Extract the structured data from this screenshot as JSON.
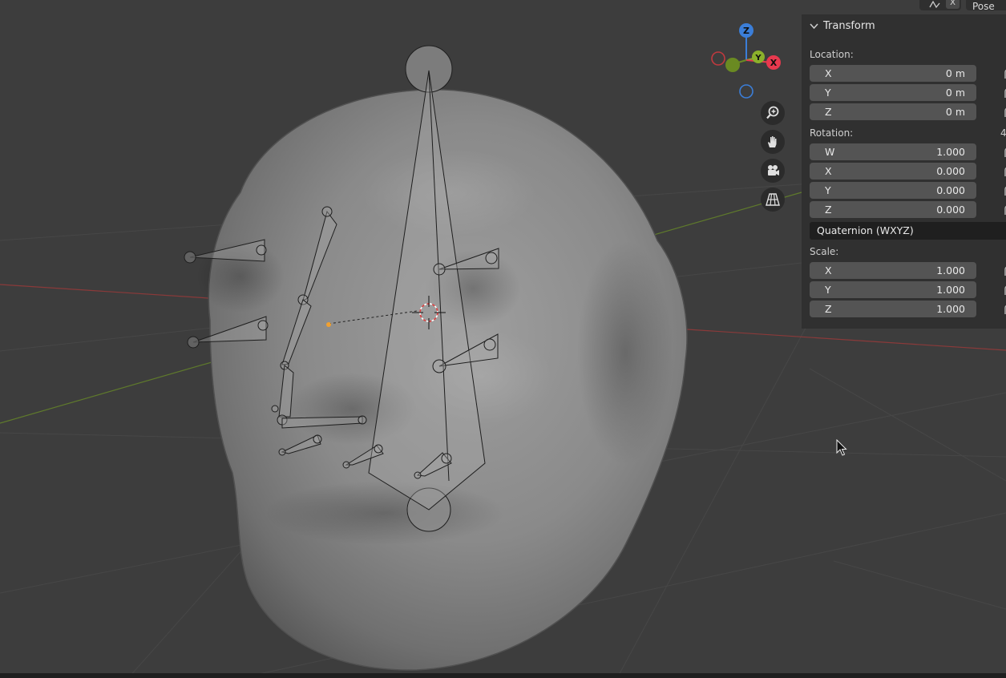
{
  "header": {
    "close_label": "X",
    "mode_label": "Pose"
  },
  "gizmo": {
    "axes": {
      "z": "Z",
      "y": "Y",
      "x": "X"
    },
    "colors": {
      "x": "#e8394e",
      "y": "#8bb12b",
      "z": "#3b7ed8"
    }
  },
  "nav_icons": [
    "zoom-icon",
    "hand-pan-icon",
    "camera-icon",
    "perspective-grid-icon"
  ],
  "transform_panel": {
    "title": "Transform",
    "location": {
      "label": "Location:",
      "fields": [
        {
          "axis": "X",
          "value": "0 m"
        },
        {
          "axis": "Y",
          "value": "0 m"
        },
        {
          "axis": "Z",
          "value": "0 m"
        }
      ]
    },
    "rotation": {
      "label": "Rotation:",
      "extra": "4",
      "fields": [
        {
          "axis": "W",
          "value": "1.000"
        },
        {
          "axis": "X",
          "value": "0.000"
        },
        {
          "axis": "Y",
          "value": "0.000"
        },
        {
          "axis": "Z",
          "value": "0.000"
        }
      ],
      "mode": "Quaternion (WXYZ)"
    },
    "scale": {
      "label": "Scale:",
      "fields": [
        {
          "axis": "X",
          "value": "1.000"
        },
        {
          "axis": "Y",
          "value": "1.000"
        },
        {
          "axis": "Z",
          "value": "1.000"
        }
      ]
    }
  }
}
